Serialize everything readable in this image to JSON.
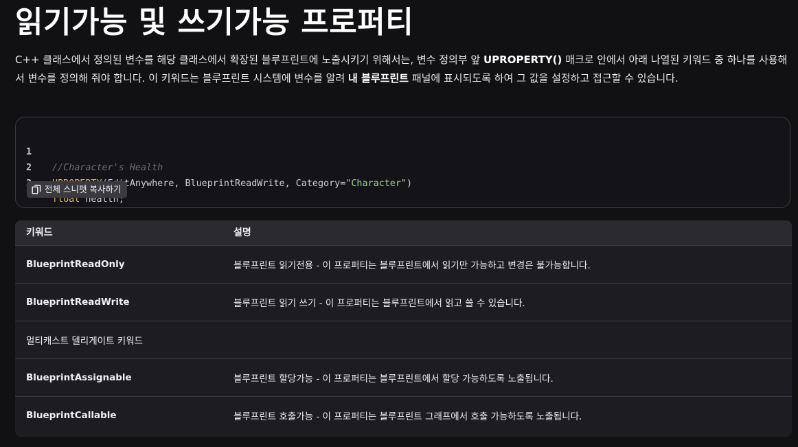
{
  "page": {
    "title": "읽기가능 및 쓰기가능 프로퍼티",
    "intro": {
      "part1": "C++ 클래스에서 정의된 변수를 해당 클래스에서 확장된 블루프린트에 노출시키기 위해서는, 변수 정의부 앞 ",
      "bold1": "UPROPERTY()",
      "part2": " 매크로 안에서 아래 나열된 키워드 중 하나를 사용해서 변수를 정의해 줘야 합니다. 이 키워드는 블루프린트 시스템에 변수를 알려 ",
      "bold2": "내 블루프린트",
      "part3": " 패널에 표시되도록 하여 그 값을 설정하고 접근할 수 있습니다."
    }
  },
  "code": {
    "lines": [
      {
        "number": "1",
        "tokens": [
          {
            "type": "comment",
            "text": "//Character's Health"
          }
        ]
      },
      {
        "number": "2",
        "tokens": [
          {
            "type": "macro",
            "text": "UPROPERTY"
          },
          {
            "type": "plain",
            "text": "(EditAnywhere, BlueprintReadWrite, Category="
          },
          {
            "type": "string",
            "text": "\"Character\""
          },
          {
            "type": "plain",
            "text": ")"
          }
        ]
      },
      {
        "number": "3",
        "tokens": [
          {
            "type": "keyword",
            "text": "float"
          },
          {
            "type": "plain",
            "text": " health;"
          }
        ]
      }
    ],
    "copy_button": {
      "label": "전체 스니펫 복사하기",
      "icon": "copy-icon"
    }
  },
  "table": {
    "headers": {
      "keyword": "키워드",
      "description": "설명"
    },
    "rows": [
      {
        "keyword": "BlueprintReadOnly",
        "description": "블루프린트 읽기전용 - 이 프로퍼티는 블루프린트에서 읽기만 가능하고 변경은 불가능합니다."
      },
      {
        "keyword": "BlueprintReadWrite",
        "description": "블루프린트 읽기 쓰기 - 이 프로퍼티는 블루프린트에서 읽고 쓸 수 있습니다."
      },
      {
        "section": "멀티캐스트 델리게이트 키워드"
      },
      {
        "keyword": "BlueprintAssignable",
        "description": "블루프린트 할당가능 - 이 프로퍼티는 블루프린트에서 할당 가능하도록 노출됩니다."
      },
      {
        "keyword": "BlueprintCallable",
        "description": "블루프린트 호출가능 - 이 프로퍼티는 블루프린트 그래프에서 호출 가능하도록 노출됩니다."
      }
    ]
  },
  "colors": {
    "background": "#111114",
    "code_background": "#141418",
    "comment": "#6b6d74",
    "macro": "#e3b66a",
    "string": "#a3d48c",
    "table_header": "#2a2a2f",
    "table_body": "#1d1d21"
  }
}
